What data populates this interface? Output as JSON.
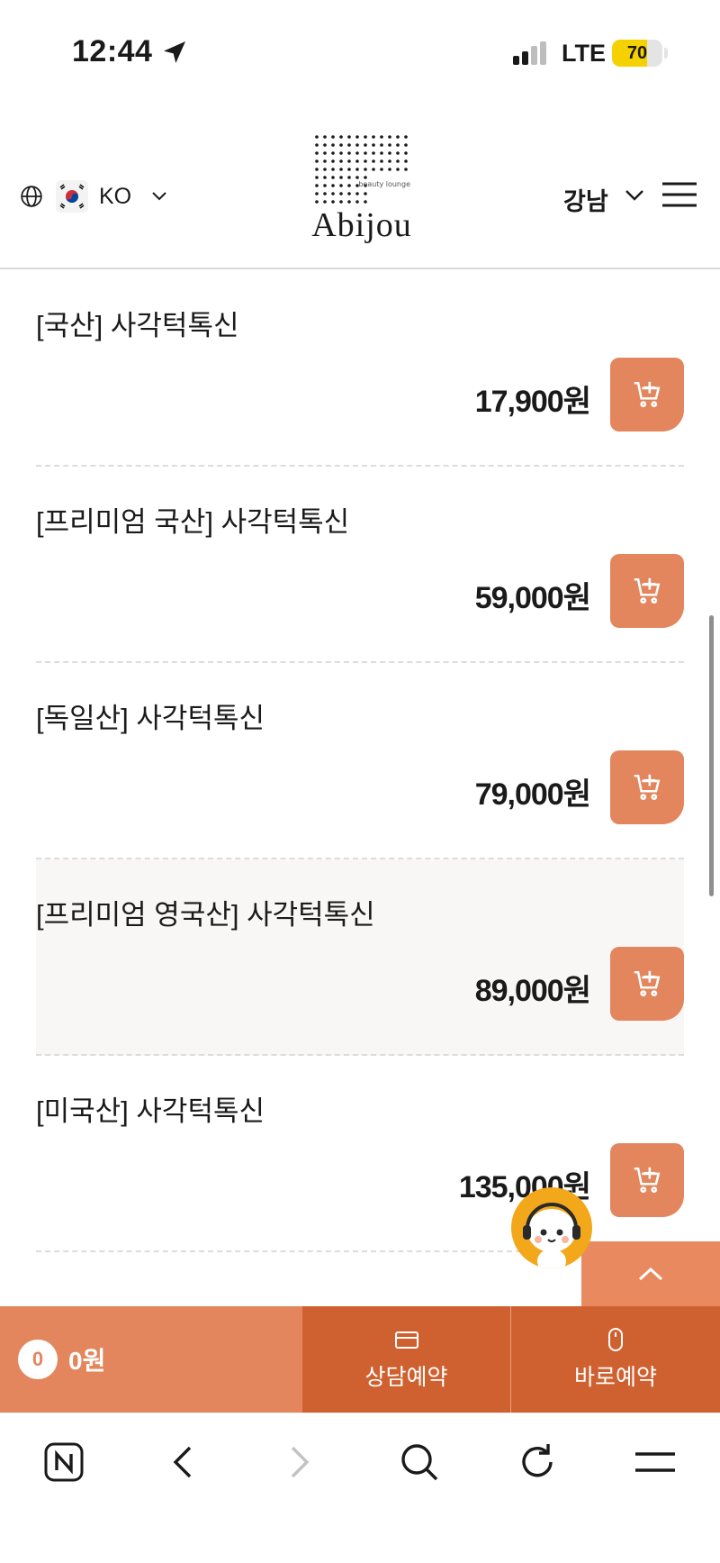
{
  "status_bar": {
    "time": "12:44",
    "network": "LTE",
    "battery": "70",
    "battery_level_percent": 70,
    "location_icon": "location-arrow-icon",
    "signal_icon": "cellular-signal-icon"
  },
  "header": {
    "language": {
      "code": "KO",
      "globe_icon": "globe-icon",
      "flag_icon": "korea-flag-icon",
      "chevron_icon": "chevron-down-icon"
    },
    "logo": {
      "brand": "Abijou",
      "tagline": "beauty lounge"
    },
    "branch": "강남",
    "menu_icon": "hamburger-menu-icon"
  },
  "products": [
    {
      "name": "[국산] 사각턱톡신",
      "price": "17,900원"
    },
    {
      "name": "[프리미엄 국산] 사각턱톡신",
      "price": "59,000원"
    },
    {
      "name": "[독일산] 사각턱톡신",
      "price": "79,000원"
    },
    {
      "name": "[프리미엄 영국산] 사각턱톡신",
      "price": "89,000원"
    },
    {
      "name": "[미국산] 사각턱톡신",
      "price": "135,000원"
    }
  ],
  "highlighted_product_index": 3,
  "action_bar": {
    "cart_count": "0",
    "cart_total": "0원",
    "consult_label": "상담예약",
    "direct_label": "바로예약"
  },
  "colors": {
    "accent": "#e3865d",
    "accent_dark": "#cf6130",
    "chatbot": "#f3a71b",
    "battery": "#f5d100"
  },
  "browser_toolbar": {
    "icons": [
      "naver-icon",
      "back-icon",
      "forward-icon",
      "search-icon",
      "reload-icon",
      "menu-icon"
    ]
  }
}
